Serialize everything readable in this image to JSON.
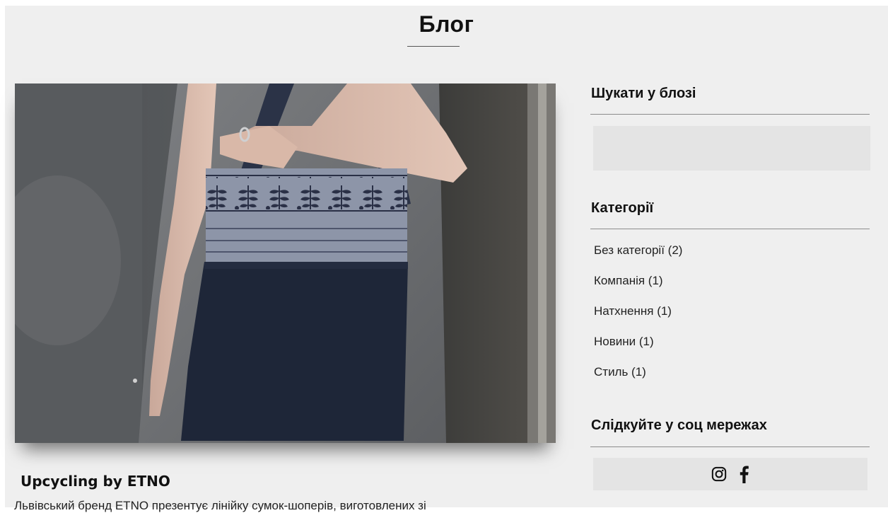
{
  "page": {
    "title": "Блог"
  },
  "post": {
    "title": "Upcycling by ETNO",
    "excerpt": "Львівський бренд ETNO презентує лінійку сумок-шоперів, виготовлених зі"
  },
  "sidebar": {
    "search_heading": "Шукати у блозі",
    "search_value": "",
    "categories_heading": "Категорії",
    "categories": [
      {
        "label": "Без категорії (2)"
      },
      {
        "label": "Компанія (1)"
      },
      {
        "label": "Натхнення (1)"
      },
      {
        "label": "Новини (1)"
      },
      {
        "label": "Стиль (1)"
      }
    ],
    "social_heading": "Слідкуйте у соц мережах",
    "social_icons": [
      "instagram-icon",
      "facebook-icon"
    ]
  },
  "colors": {
    "page_bg": "#efefef",
    "field_bg": "#e4e4e4",
    "text": "#111111"
  }
}
